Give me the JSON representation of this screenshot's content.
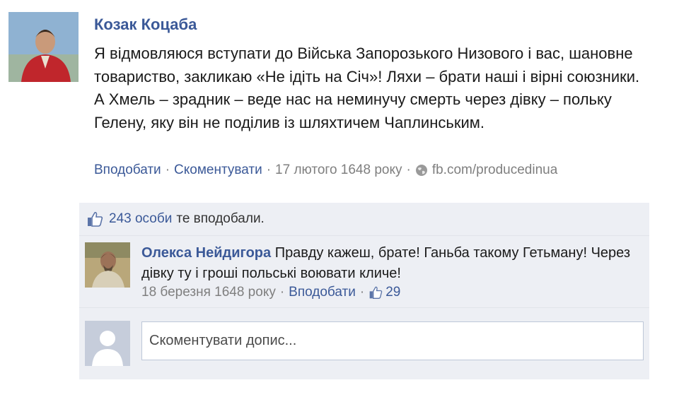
{
  "post": {
    "author": "Козак Коцаба",
    "text": "Я відмовляюся вступати до Війська Запорозького Низового і вас, шановне товариство, закликаю «Не ідіть на Січ»! Ляхи – брати наші і вірні союзники. А Хмель – зрадник – веде нас на неминучу смерть через дівку – польку Гелену, яку він не поділив із шляхтичем Чаплинським.",
    "actions": {
      "like": "Вподобати",
      "comment": "Скоментувати",
      "separator": "·",
      "date": "17 лютого 1648 року",
      "source": "fb.com/producedinua"
    }
  },
  "likes": {
    "count_link": "243 особи",
    "suffix": "те вподобали."
  },
  "comment": {
    "author": "Олекса Нейдигора",
    "text": "Правду кажеш, брате! Ганьба такому Гетьману! Через дівку ту і гроші польські воювати кличе!",
    "date": "18 березня 1648 року",
    "like": "Вподобати",
    "separator": "·",
    "like_count": "29"
  },
  "composer": {
    "placeholder": "Скоментувати допис..."
  },
  "colors": {
    "link": "#3b5998",
    "muted": "#7f7f7f",
    "ufi_background": "#edeff4"
  },
  "icons": [
    "globe-icon",
    "thumbs-up-icon",
    "default-avatar-icon"
  ]
}
